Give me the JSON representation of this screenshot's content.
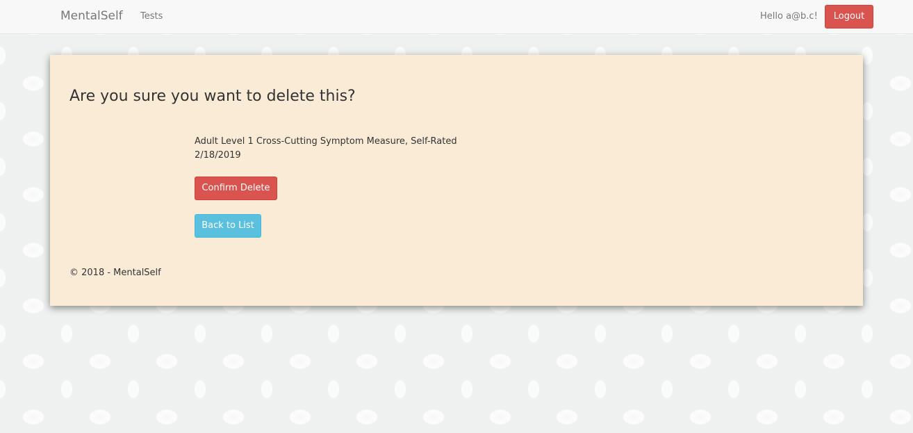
{
  "nav": {
    "brand": "MentalSelf",
    "links": [
      {
        "label": "Tests"
      }
    ],
    "greeting": "Hello a@b.c!",
    "logout_label": "Logout"
  },
  "main": {
    "heading": "Are you sure you want to delete this?",
    "item": {
      "name": "Adult Level 1 Cross-Cutting Symptom Measure, Self-Rated",
      "date": "2/18/2019"
    },
    "confirm_label": "Confirm Delete",
    "back_label": "Back to List"
  },
  "footer": {
    "text": "© 2018 - MentalSelf"
  },
  "colors": {
    "danger": "#d9534f",
    "info": "#5bc0de",
    "card_background": "#faebd7",
    "navbar_background": "#f8f8f8"
  }
}
